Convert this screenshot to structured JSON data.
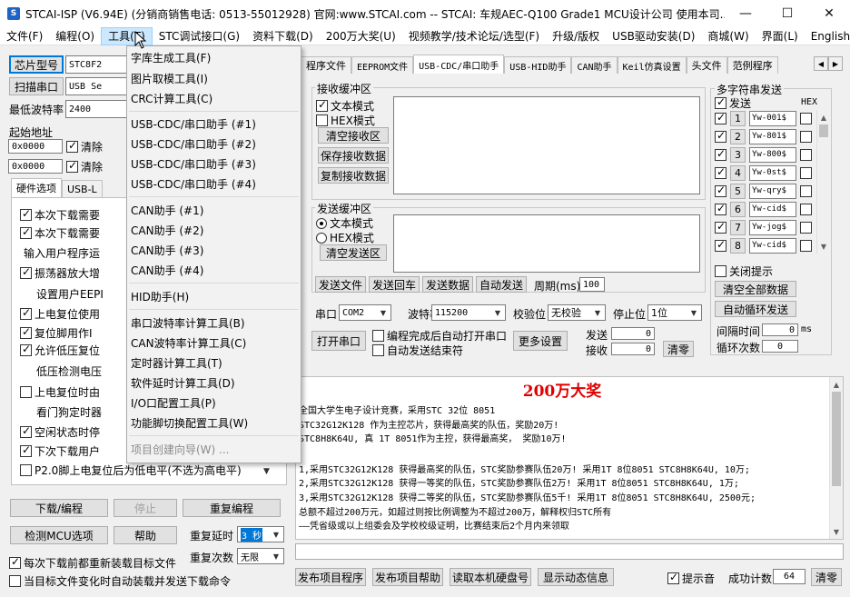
{
  "window": {
    "title": "STCAI-ISP (V6.94E) (分销商销售电话: 0513-55012928) 官网:www.STCAI.com  -- STCAI: 车规AEC-Q100 Grade1 MCU设计公司 使用本司...",
    "minimize": "—",
    "maximize": "☐",
    "close": "✕"
  },
  "menu": [
    "文件(F)",
    "编程(O)",
    "工具(T)",
    "STC调试接口(G)",
    "资料下载(D)",
    "200万大奖(U)",
    "视频教学/技术论坛/选型(F)",
    "升级/版权",
    "USB驱动安装(D)",
    "商城(W)",
    "界面(L)",
    "English"
  ],
  "tools_menu": {
    "items": [
      "字库生成工具(F)",
      "图片取模工具(I)",
      "CRC计算工具(C)",
      "USB-CDC/串口助手 (#1)",
      "USB-CDC/串口助手 (#2)",
      "USB-CDC/串口助手 (#3)",
      "USB-CDC/串口助手 (#4)",
      "CAN助手 (#1)",
      "CAN助手 (#2)",
      "CAN助手 (#3)",
      "CAN助手 (#4)",
      "HID助手(H)",
      "串口波特率计算工具(B)",
      "CAN波特率计算工具(C)",
      "定时器计算工具(T)",
      "软件延时计算工具(D)",
      "I/O口配置工具(P)",
      "功能脚切换配置工具(W)",
      "项目创建向导(W) ..."
    ]
  },
  "left": {
    "chip_type_btn": "芯片型号",
    "chip_value": "STC8F2",
    "scan_port_btn": "扫描串口",
    "port_value": "USB Se",
    "min_baud_label": "最低波特率",
    "min_baud_value": "2400",
    "start_addr_label": "起始地址",
    "addr1": "0x0000",
    "addr2": "0x0000",
    "clear1": "清除",
    "clear2": "清除",
    "tabs": [
      "硬件选项",
      "USB-L"
    ],
    "options": [
      "本次下载需要",
      "本次下载需要",
      "输入用户程序运",
      "振荡器放大增",
      "设置用户EEPI",
      "上电复位使用",
      "复位脚用作I",
      "允许低压复位",
      "低压检测电压",
      "上电复位时由",
      "看门狗定时器",
      "空闲状态时停",
      "下次下载用户",
      "P2.0脚上电复位后为低电平(不选为高电平)"
    ],
    "download_btn": "下载/编程",
    "stop_btn": "停止",
    "reprogram_btn": "重复编程",
    "check_mcu_btn": "检测MCU选项",
    "help_btn": "帮助",
    "repeat_delay_label": "重复延时",
    "repeat_delay_value": "3 秒",
    "repeat_count_label": "重复次数",
    "repeat_count_value": "无限",
    "reload_each": "每次下载前都重新装载目标文件",
    "auto_download": "当目标文件变化时自动装载并发送下载命令"
  },
  "right_tabs": [
    "程序文件",
    "EEPROM文件",
    "USB-CDC/串口助手",
    "USB-HID助手",
    "CAN助手",
    "Keil仿真设置",
    "头文件",
    "范例程序"
  ],
  "serial": {
    "rx_group": "接收缓冲区",
    "rx_text_mode": "文本模式",
    "rx_hex_mode": "HEX模式",
    "clear_rx": "清空接收区",
    "save_rx": "保存接收数据",
    "copy_rx": "复制接收数据",
    "tx_group": "发送缓冲区",
    "tx_text_mode": "文本模式",
    "tx_hex_mode": "HEX模式",
    "clear_tx": "清空发送区",
    "send_file": "发送文件",
    "send_enter": "发送回车",
    "send_data": "发送数据",
    "auto_send": "自动发送",
    "period_label": "周期(ms)",
    "period_value": "100",
    "port_label": "串口",
    "port_value": "COM2",
    "baud_label": "波特率",
    "baud_value": "115200",
    "parity_label": "校验位",
    "parity_value": "无校验",
    "stop_label": "停止位",
    "stop_value": "1位",
    "open_port_btn": "打开串口",
    "auto_open": "编程完成后自动打开串口",
    "auto_close": "自动发送结束符",
    "more_settings": "更多设置",
    "sent_label": "发送",
    "sent_value": "0",
    "recv_label": "接收",
    "recv_value": "0",
    "clear_counts": "清零"
  },
  "multi_send": {
    "title": "多字符串发送",
    "send_col": "发送",
    "hex_col": "HEX",
    "rows": [
      {
        "num": "1",
        "text": "Yw-001$"
      },
      {
        "num": "2",
        "text": "Yw-801$"
      },
      {
        "num": "3",
        "text": "Yw-800$"
      },
      {
        "num": "4",
        "text": "Yw-0st$"
      },
      {
        "num": "5",
        "text": "Yw-qry$"
      },
      {
        "num": "6",
        "text": "Yw-cid$"
      },
      {
        "num": "7",
        "text": "Yw-jog$"
      },
      {
        "num": "8",
        "text": "Yw-cid$"
      }
    ],
    "close_hint": "关闭提示",
    "clear_all": "清空全部数据",
    "auto_loop": "自动循环发送",
    "interval_label": "间隔时间",
    "interval_value": "0",
    "interval_unit": "ms",
    "loop_count_label": "循环次数",
    "loop_count_value": "0"
  },
  "banner": {
    "title": "200万大奖",
    "lines": [
      "全国大学生电子设计竞赛，采用STC 32位 8051",
      "STC32G12K128 作为主控芯片，获得最高奖的队伍，奖励20万!",
      "STC8H8K64U, 真 1T 8051作为主控，获得最高奖，  奖励10万!",
      "",
      "1,采用STC32G12K128 获得最高奖的队伍，STC奖励参赛队伍20万! 采用1T 8位8051 STC8H8K64U, 10万;",
      "2,采用STC32G12K128 获得一等奖的队伍，STC奖励参赛队伍2万!  采用1T 8位8051 STC8H8K64U, 1万;",
      "3,采用STC32G12K128 获得二等奖的队伍，STC奖励参赛队伍5千!  采用1T 8位8051 STC8H8K64U, 2500元;",
      "总额不超过200万元，如超过则按比例调整为不超过200万，解释权归STC所有",
      "——凭省级或以上组委会及学校校级证明，比赛结束后2个月内来领取"
    ]
  },
  "bottom": {
    "publish_program": "发布项目程序",
    "publish_help": "发布项目帮助",
    "read_disk": "读取本机硬盘号",
    "show_dynamic": "显示动态信息",
    "beep": "提示音",
    "success_label": "成功计数",
    "success_value": "64",
    "clear": "清零"
  }
}
